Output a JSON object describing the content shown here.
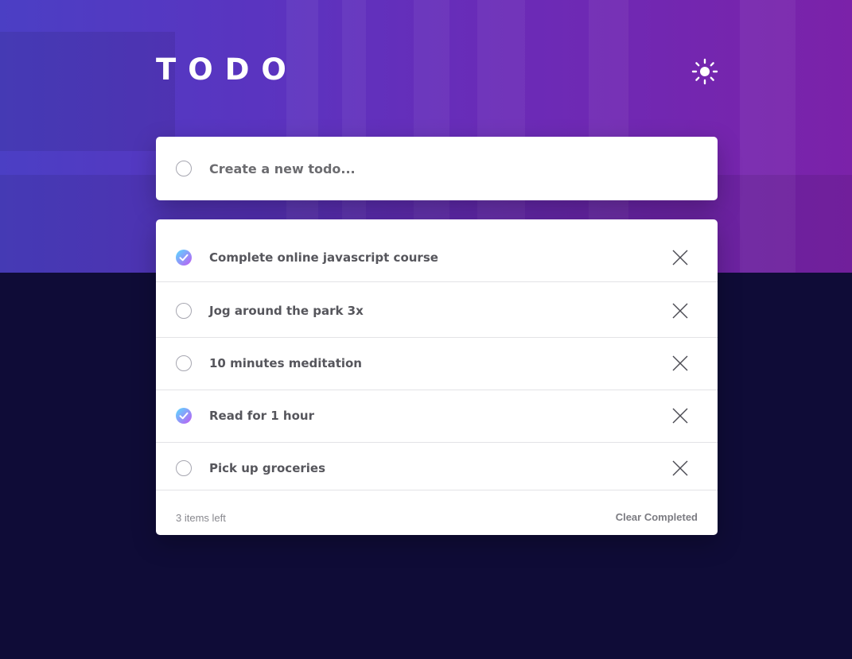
{
  "app": {
    "title": "TODO",
    "accent_gradient": [
      "#57ddff",
      "#c058f3"
    ],
    "hero_colors": [
      "#4b3fc4",
      "#7b22a9"
    ],
    "background_color": "#0f0c37",
    "theme_icon": "sun-icon"
  },
  "new_todo": {
    "placeholder": "Create a new todo...",
    "value": ""
  },
  "todos": [
    {
      "text": "Complete online javascript course",
      "completed": true
    },
    {
      "text": "Jog around the park 3x",
      "completed": false
    },
    {
      "text": "10 minutes meditation",
      "completed": false
    },
    {
      "text": "Read for 1 hour",
      "completed": true
    },
    {
      "text": "Pick up groceries",
      "completed": false
    }
  ],
  "footer": {
    "items_left": "3 items left",
    "clear_completed": "Clear Completed"
  },
  "icons": {
    "check": "check-icon",
    "delete": "close-icon"
  }
}
